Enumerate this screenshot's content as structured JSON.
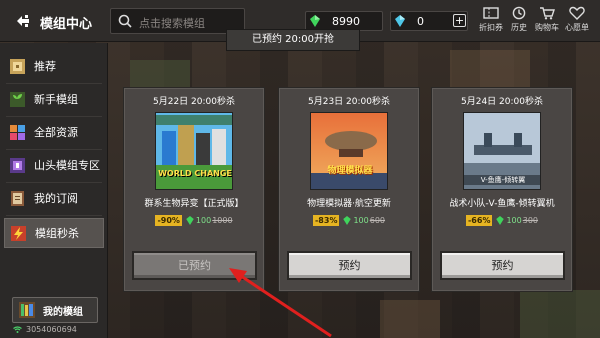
{
  "header": {
    "title": "模组中心",
    "search_placeholder": "点击搜索模组",
    "currency_green": "8990",
    "currency_blue": "0",
    "plus": "+",
    "nav": [
      {
        "label": "折扣券",
        "icon": "coupon-icon"
      },
      {
        "label": "历史",
        "icon": "history-icon"
      },
      {
        "label": "购物车",
        "icon": "cart-icon"
      },
      {
        "label": "心愿单",
        "icon": "heart-icon"
      }
    ]
  },
  "toast": "已预约 20:00开抢",
  "sidebar": {
    "items": [
      {
        "label": "推荐",
        "icon": "recommend-icon"
      },
      {
        "label": "新手模组",
        "icon": "sprout-icon"
      },
      {
        "label": "全部资源",
        "icon": "blocks-icon"
      },
      {
        "label": "山头模组专区",
        "icon": "portal-icon"
      },
      {
        "label": "我的订阅",
        "icon": "subscribe-icon"
      },
      {
        "label": "模组秒杀",
        "icon": "flash-icon"
      }
    ],
    "my_mods": "我的模组",
    "user_id": "3054060694"
  },
  "cards": [
    {
      "time": "5月22日 20:00秒杀",
      "name": "群系生物异变【正式版】",
      "discount": "-90%",
      "price_now": "100",
      "price_old": "1000",
      "button": "已预约",
      "thumb_label": "WORLD CHANGE"
    },
    {
      "time": "5月23日 20:00秒杀",
      "name": "物理模拟器·航空更新",
      "discount": "-83%",
      "price_now": "100",
      "price_old": "600",
      "button": "预约",
      "thumb_label": "物理模拟器"
    },
    {
      "time": "5月24日 20:00秒杀",
      "name": "战术小队-V-鱼鹰-倾转翼机",
      "discount": "-66%",
      "price_now": "100",
      "price_old": "300",
      "button": "预约",
      "thumb_label": "V-鱼鹰-倾转翼"
    }
  ],
  "colors": {
    "accent_green": "#7fe08a",
    "discount_yellow": "#e6b422",
    "arrow_red": "#e0201e"
  }
}
